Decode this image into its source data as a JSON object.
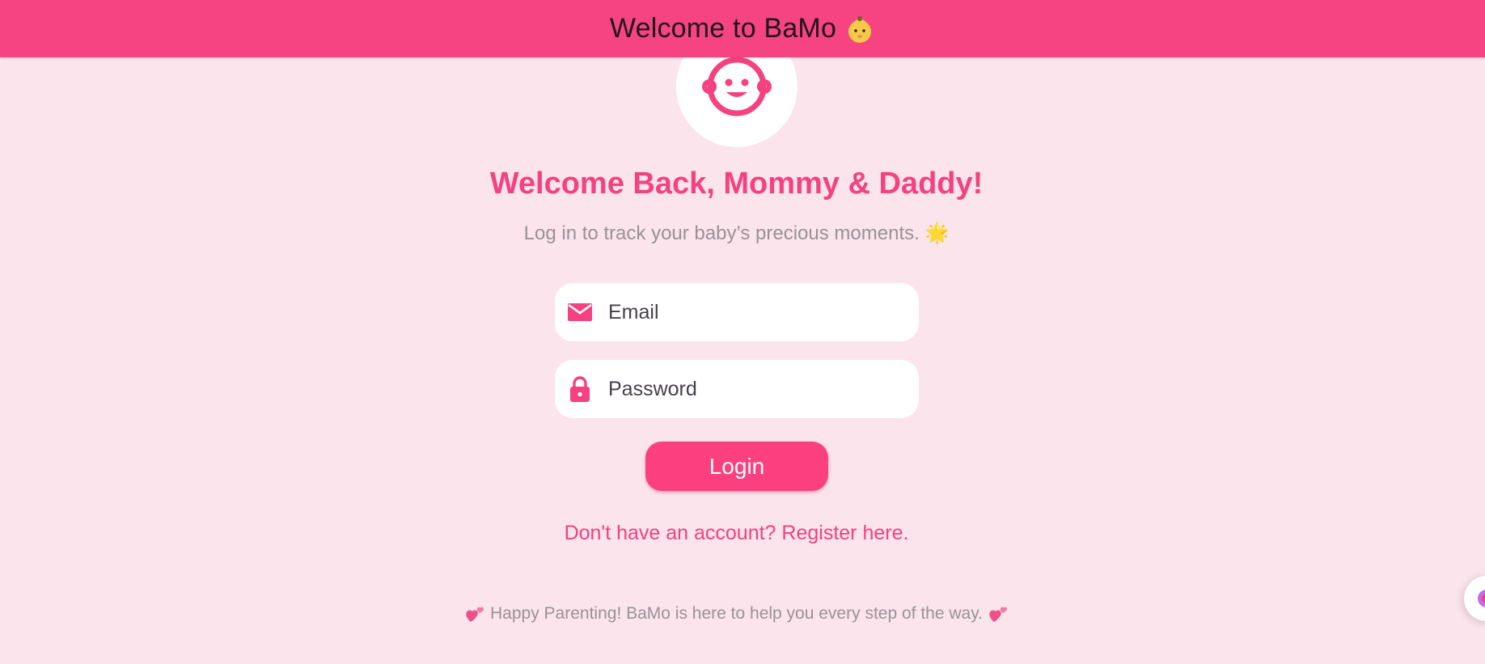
{
  "appbar": {
    "title": "Welcome to BaMo",
    "title_emoji": "baby-emoji",
    "bg_color": "#f64483"
  },
  "avatar": {
    "icon": "baby-face-icon"
  },
  "headline": "Welcome Back, Mommy & Daddy!",
  "subline": "Log in to track your baby’s precious moments. 🌟",
  "form": {
    "email": {
      "placeholder": "Email",
      "value": "",
      "icon": "mail-icon"
    },
    "password": {
      "placeholder": "Password",
      "value": "",
      "icon": "lock-icon"
    },
    "login_label": "Login"
  },
  "register_link": "Don't have an account? Register here.",
  "footer": {
    "text": "Happy Parenting! BaMo is here to help you every step of the way.",
    "emoji": "two-hearts-emoji"
  },
  "colors": {
    "accent": "#f5417f",
    "background": "#fbe4ec",
    "muted_text": "#9a9196"
  }
}
